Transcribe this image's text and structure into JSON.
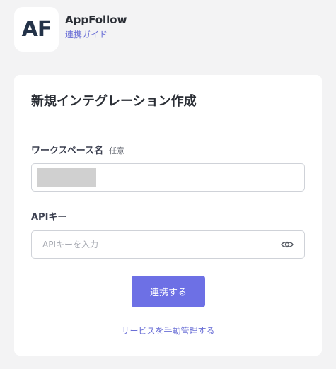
{
  "header": {
    "logo_text": "AF",
    "app_name": "AppFollow",
    "guide_link": "連携ガイド"
  },
  "card": {
    "title": "新規インテグレーション作成",
    "workspace": {
      "label": "ワークスペース名",
      "optional": "任意",
      "value": ""
    },
    "api_key": {
      "label": "APIキー",
      "placeholder": "APIキーを入力",
      "value": ""
    },
    "submit_label": "連携する",
    "manual_link": "サービスを手動管理する"
  },
  "colors": {
    "accent": "#6d70e5",
    "link": "#6a6fd6",
    "logo_text": "#233248",
    "background": "#f3f3f4"
  },
  "icons": {
    "show_password": "eye-icon"
  }
}
